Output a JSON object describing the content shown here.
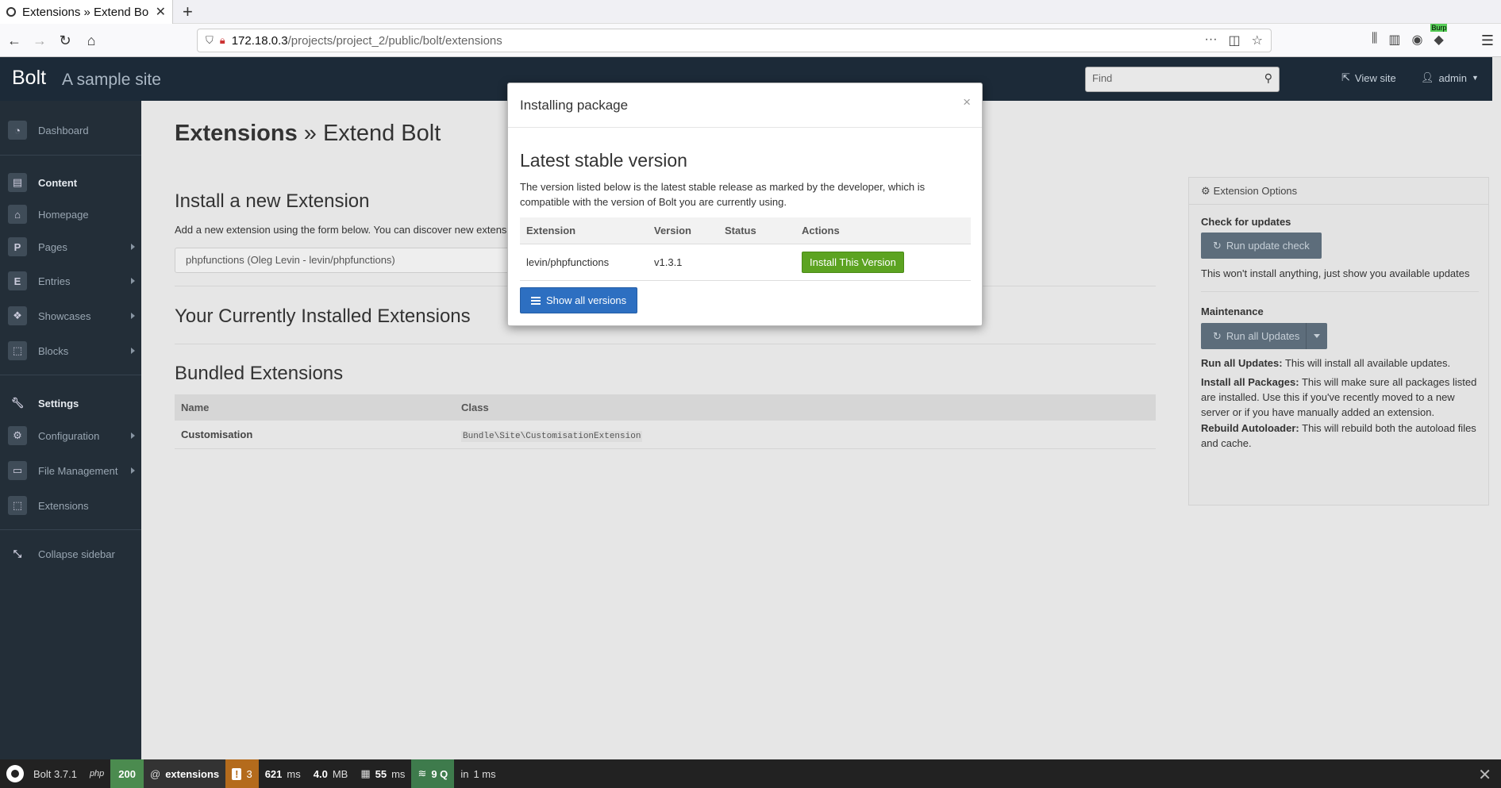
{
  "browser": {
    "tab_title": "Extensions » Extend Bolt",
    "url_host": "172.18.0.3",
    "url_path": "/projects/project_2/public/bolt/extensions",
    "new_tab": "+",
    "url_more": "···",
    "burp_label": "Burp"
  },
  "header": {
    "brand": "Bolt",
    "site_name": "A sample site",
    "search_placeholder": "Find",
    "view_site": "View site",
    "user": "admin"
  },
  "sidebar": {
    "dashboard": "Dashboard",
    "content": "Content",
    "homepage": "Homepage",
    "pages": "Pages",
    "pages_icon_letter": "P",
    "entries": "Entries",
    "entries_icon_letter": "E",
    "showcases": "Showcases",
    "blocks": "Blocks",
    "settings": "Settings",
    "configuration": "Configuration",
    "file_management": "File Management",
    "extensions": "Extensions",
    "collapse": "Collapse sidebar"
  },
  "main": {
    "title_bold": "Extensions",
    "title_rest": " » Extend Bolt",
    "install_heading": "Install a new Extension",
    "install_desc": "Add a new extension using the form below. You can discover new extensi",
    "install_value": "phpfunctions (Oleg Levin - levin/phpfunctions)",
    "installed_heading": "Your Currently Installed Extensions",
    "bundled_heading": "Bundled Extensions",
    "bundled_columns": [
      "Name",
      "Class"
    ],
    "bundled_rows": [
      {
        "name": "Customisation",
        "class": "Bundle\\Site\\CustomisationExtension"
      }
    ]
  },
  "panel": {
    "title": "Extension Options",
    "check_label": "Check for updates",
    "run_check": "Run update check",
    "check_note": "This won't install anything, just show you available updates",
    "maintenance_label": "Maintenance",
    "run_all": "Run all Updates",
    "run_all_bold": "Run all Updates:",
    "run_all_text": " This will install all available updates.",
    "install_all_bold": "Install all Packages:",
    "install_all_text": " This will make sure all packages listed are installed. Use this if you've recently moved to a new server or if you have manually added an extension.",
    "rebuild_bold": "Rebuild Autoloader:",
    "rebuild_text": " This will rebuild both the autoload files and cache."
  },
  "modal": {
    "title": "Installing package",
    "close": "×",
    "heading": "Latest stable version",
    "description": "The version listed below is the latest stable release as marked by the developer, which is compatible with the version of Bolt you are currently using.",
    "columns": [
      "Extension",
      "Version",
      "Status",
      "Actions"
    ],
    "rows": [
      {
        "extension": "levin/phpfunctions",
        "version": "v1.3.1",
        "status": "",
        "action": "Install This Version"
      }
    ],
    "show_all": "Show all versions"
  },
  "debugbar": {
    "version": "Bolt 3.7.1",
    "php": "php",
    "status": "200",
    "route_at": "@",
    "route": "extensions",
    "warnings": "3",
    "time_value": "621",
    "time_unit": "ms",
    "memory_value": "4.0",
    "memory_unit": "MB",
    "render_value": "55",
    "render_unit": "ms",
    "queries": "9 Q",
    "query_time_prefix": "in",
    "query_time": "1 ms",
    "close": "✕"
  },
  "colors": {
    "header_bg": "#1c2a38",
    "sidebar_bg": "#232e38",
    "primary_button": "#2d6fc1",
    "install_button": "#5ca321",
    "status_ok": "#4b8b4f"
  }
}
